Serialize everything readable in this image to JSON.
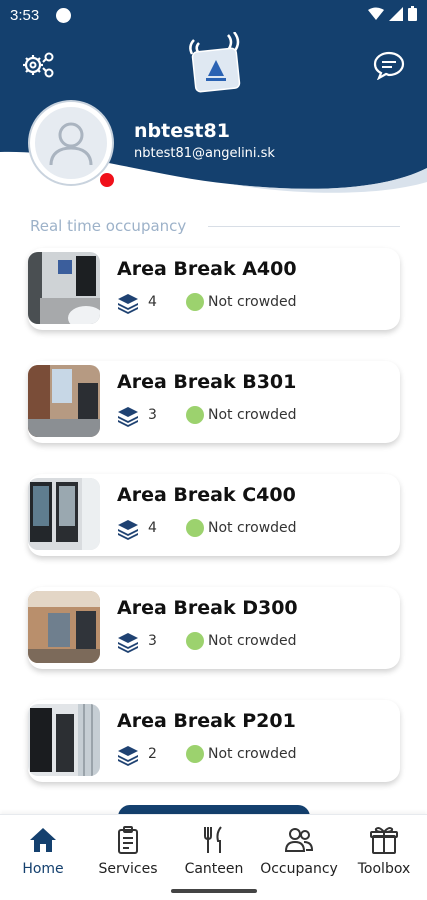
{
  "status_bar": {
    "time": "3:53"
  },
  "header": {
    "settings_icon": "gear-network-icon",
    "chat_icon": "chat-bubble-icon",
    "logo_icon": "angelini-card-logo",
    "brand_color": "#14406e"
  },
  "user": {
    "name": "nbtest81",
    "email": "nbtest81@angelini.sk",
    "presence_color": "#f0101a"
  },
  "section": {
    "title": "Real time occupancy"
  },
  "areas": [
    {
      "name": "Area Break A400",
      "floor": "4",
      "status": "Not crowded"
    },
    {
      "name": "Area Break B301",
      "floor": "3",
      "status": "Not crowded"
    },
    {
      "name": "Area Break C400",
      "floor": "4",
      "status": "Not crowded"
    },
    {
      "name": "Area Break D300",
      "floor": "3",
      "status": "Not crowded"
    },
    {
      "name": "Area Break P201",
      "floor": "2",
      "status": "Not crowded"
    }
  ],
  "status_color": "#9cd26e",
  "nav": [
    {
      "label": "Home",
      "icon": "home-icon",
      "active": true
    },
    {
      "label": "Services",
      "icon": "clipboard-icon",
      "active": false
    },
    {
      "label": "Canteen",
      "icon": "fork-knife-icon",
      "active": false
    },
    {
      "label": "Occupancy",
      "icon": "people-icon",
      "active": false
    },
    {
      "label": "Toolbox",
      "icon": "gift-box-icon",
      "active": false
    }
  ]
}
